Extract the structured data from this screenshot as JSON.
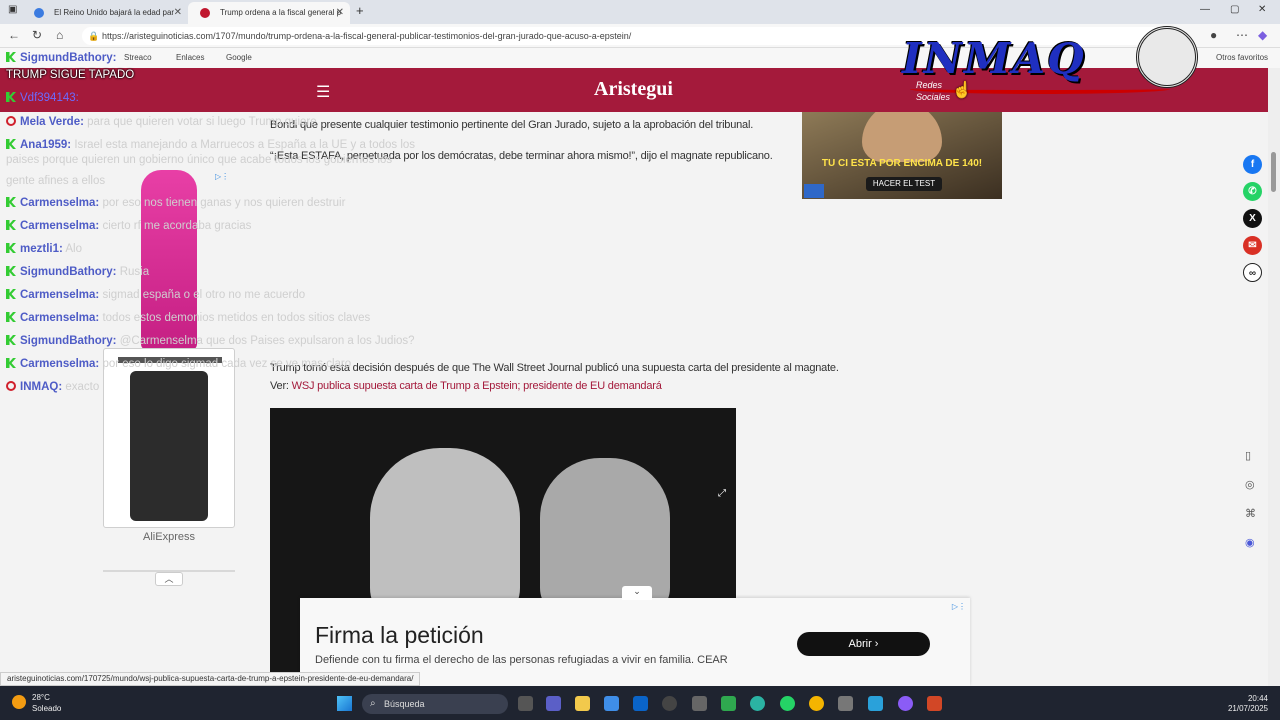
{
  "browser": {
    "tabs": [
      {
        "title": "El Reino Unido bajará la edad par",
        "favicon_color": "#3b7be0"
      },
      {
        "title": "Trump ordena a la fiscal general p",
        "favicon_color": "#c0162e"
      }
    ],
    "url": "https://aristeguinoticias.com/1707/mundo/trump-ordena-a-la-fiscal-general-publicar-testimonios-del-gran-jurado-que-acuso-a-epstein/",
    "bookmarks": [
      "Streaco",
      "Enlaces",
      "Google"
    ],
    "other_bookmarks": "Otros favoritos"
  },
  "site": {
    "logo": "Aristegui",
    "redes_line1": "Redes",
    "redes_line2": "Sociales",
    "brand_color": "#a41a3b"
  },
  "article": {
    "p1": "Bondi que presente cualquier testimonio pertinente del Gran Jurado, sujeto a la aprobación del tribunal.",
    "p2": "“¡Esta ESTAFA, perpetuada por los demócratas, debe terminar ahora mismo!”, dijo el magnate republicano.",
    "p3": "Trump tomó esta decisión después de que The Wall Street Journal publicó una supuesta carta del presidente al magnate.",
    "see_label": "Ver:",
    "see_link": "WSJ publica supuesta carta de Trump a Epstein; presidente de EU demandará"
  },
  "ad_top": {
    "headline": "TU CI ESTA POR ENCIMA DE 140!",
    "cta": "HACER EL TEST"
  },
  "chat": {
    "pinned": "TRUMP SIGUE TAPADO",
    "messages": [
      {
        "user": "SigmundBathory:",
        "msg": "",
        "icon": "k"
      },
      {
        "user": "Vdf394143:",
        "msg": "",
        "icon": "k"
      },
      {
        "user": "Mela Verde:",
        "msg": "para que quieren votar si luego Trump quiere",
        "icon": "yt"
      },
      {
        "user": "Ana1959:",
        "msg": "Israel esta manejando a Marruecos a España a la UE y a todos los",
        "icon": "k"
      },
      {
        "user": "Carmenselma:",
        "msg": "por eso nos tienen ganas y nos quieren destruir",
        "icon": "k"
      },
      {
        "user": "Carmenselma:",
        "msg": "cierto rf me acordaba gracias",
        "icon": "k"
      },
      {
        "user": "meztli1:",
        "msg": "Alo",
        "icon": "k"
      },
      {
        "user": "SigmundBathory:",
        "msg": "Rusia",
        "icon": "k"
      },
      {
        "user": "Carmenselma:",
        "msg": "sigmad españa o el otro no me acuerdo",
        "icon": "k"
      },
      {
        "user": "Carmenselma:",
        "msg": "todos estos demonios metidos en todos sitios claves",
        "icon": "k"
      },
      {
        "user": "SigmundBathory:",
        "msg": "@Carmenselma que dos Paises expulsaron a los Judios?",
        "icon": "k"
      },
      {
        "user": "Carmenselma:",
        "msg": "por eso lo digo sigmad cada vez se ve mas claro",
        "icon": "k"
      },
      {
        "user": "INMAQ:",
        "msg": "exacto",
        "icon": "yt"
      }
    ],
    "ana_line2": "paises porque quieren un gobierno único que acabe todos los gobiernos los",
    "ana_line3": "gente afines a ellos"
  },
  "left_ad": {
    "brand": "AliExpress"
  },
  "petition": {
    "title": "Firma la petición",
    "desc": "Defiende con tu firma el derecho de las personas refugiadas a vivir en familia. CEAR",
    "button": "Abrir"
  },
  "status_url": "aristeguinoticias.com/170725/mundo/wsj-publica-supuesta-carta-de-trump-a-epstein-presidente-de-eu-demandara/",
  "watermark": "INMAQ",
  "taskbar": {
    "temp": "28°C",
    "weather": "Soleado",
    "search": "Búsqueda",
    "time": "20:44",
    "date": "21/07/2025"
  }
}
